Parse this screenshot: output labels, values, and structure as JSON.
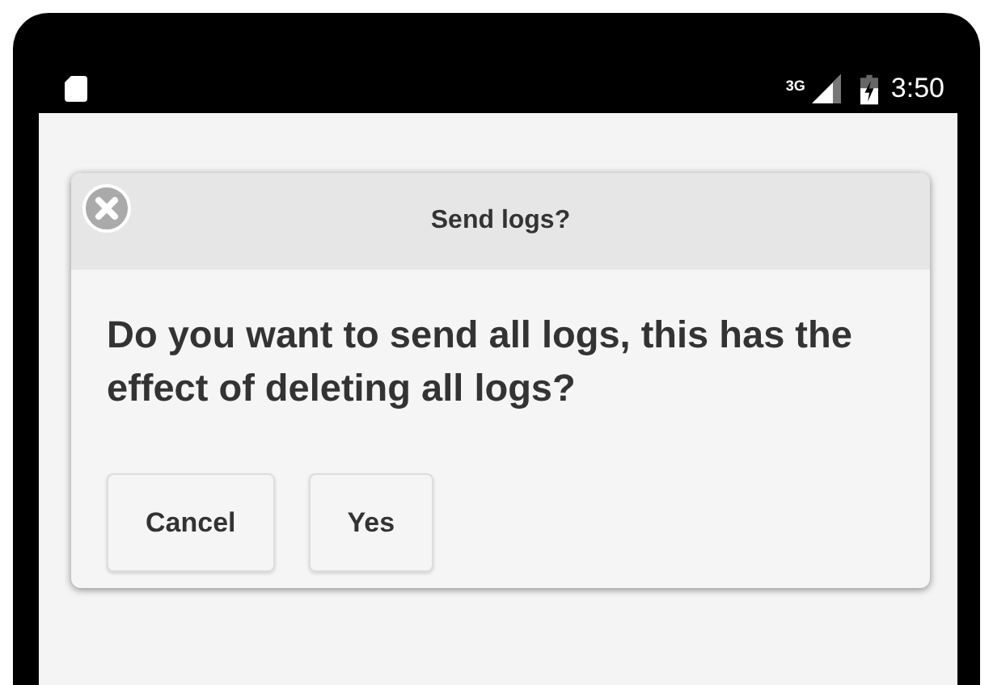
{
  "status_bar": {
    "network": "3G",
    "time": "3:50"
  },
  "dialog": {
    "title": "Send logs?",
    "message": "Do you want to send all logs, this has the effect of deleting all logs?",
    "buttons": [
      "Cancel",
      "Yes"
    ]
  }
}
